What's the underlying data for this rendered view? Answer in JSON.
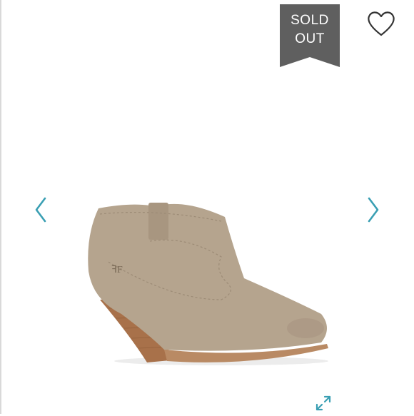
{
  "badge": {
    "line1": "SOLD",
    "line2": "OUT",
    "color": "#5f5f5f"
  },
  "icons": {
    "favorite": "heart-icon",
    "previous": "chevron-left-icon",
    "next": "chevron-right-icon",
    "expand": "expand-icon"
  },
  "colors": {
    "accent": "#3a9fb3",
    "suede": "#b5a48e",
    "heel": "#a8714a"
  }
}
